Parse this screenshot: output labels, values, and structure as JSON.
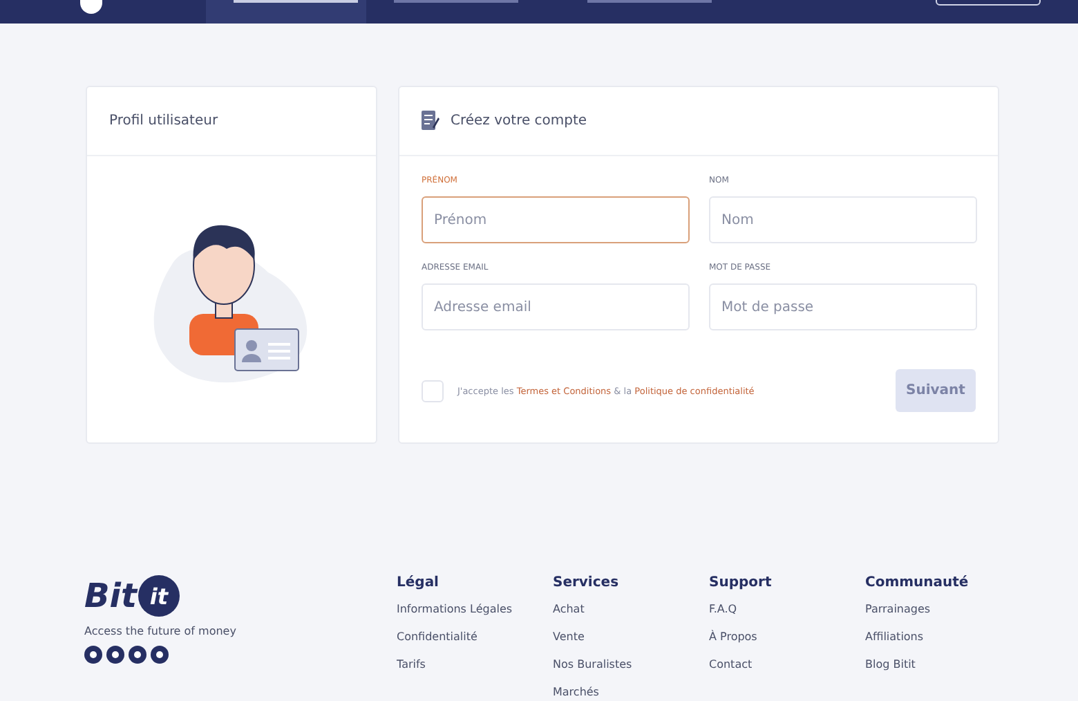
{
  "header": {
    "tabs": [
      {
        "selected": true
      },
      {
        "selected": false
      },
      {
        "selected": false
      }
    ]
  },
  "profile_card": {
    "title": "Profil utilisateur"
  },
  "form_card": {
    "title": "Créez votre compte",
    "fields": [
      {
        "label": "PRÉNOM",
        "placeholder": "Prénom",
        "focused": true
      },
      {
        "label": "NOM",
        "placeholder": "Nom",
        "focused": false
      },
      {
        "label": "ADRESSE EMAIL",
        "placeholder": "Adresse email",
        "focused": false
      },
      {
        "label": "MOT DE PASSE",
        "placeholder": "Mot de passe",
        "focused": false
      }
    ],
    "terms": {
      "checked": false,
      "prefix": "J'accepte les",
      "link1": "Termes et Conditions",
      "middle": "& la",
      "link2": "Politique de confidentialité"
    },
    "submit": {
      "label": "Suivant",
      "disabled": true
    }
  },
  "footer": {
    "brand": {
      "logo_text": "Bit",
      "logo_badge": "it",
      "tagline": "Access the future of money"
    },
    "columns": [
      {
        "title": "Légal",
        "links": [
          "Informations Légales",
          "Confidentialité",
          "Tarifs"
        ]
      },
      {
        "title": "Services",
        "links": [
          "Achat",
          "Vente",
          "Nos Buralistes",
          "Marchés"
        ]
      },
      {
        "title": "Support",
        "links": [
          "F.A.Q",
          "À Propos",
          "Contact"
        ]
      },
      {
        "title": "Communauté",
        "links": [
          "Parrainages",
          "Affiliations",
          "Blog Bitit"
        ]
      }
    ]
  }
}
